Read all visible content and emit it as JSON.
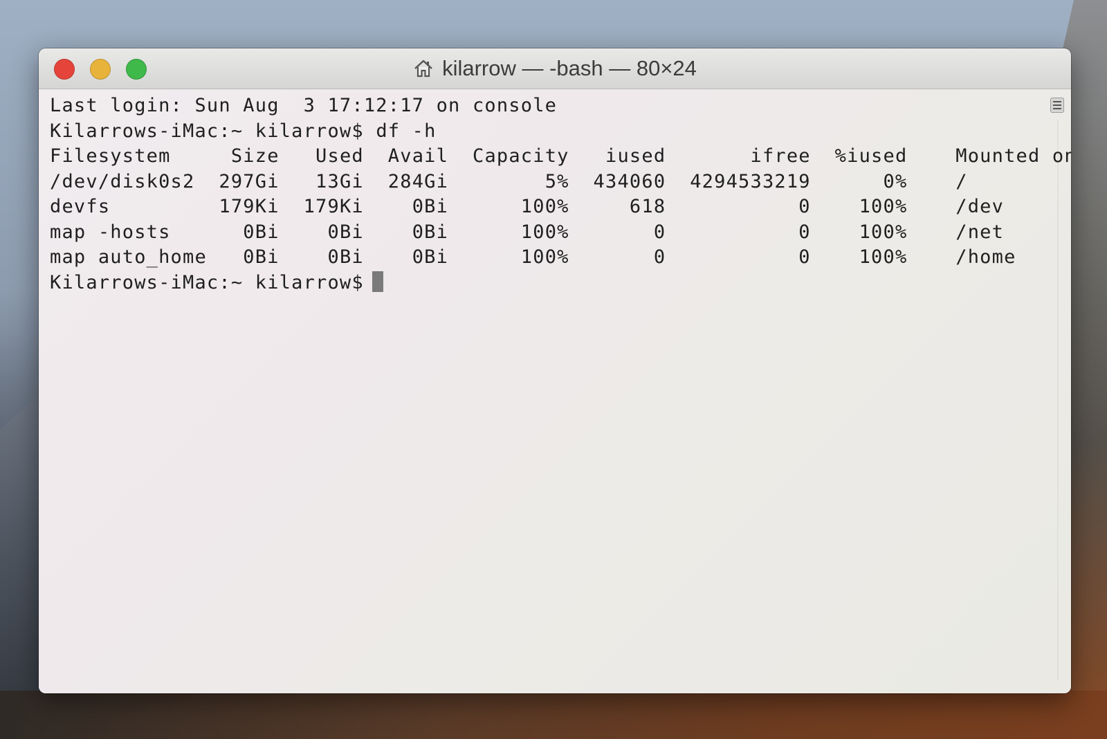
{
  "window": {
    "title": "kilarrow — -bash — 80×24",
    "title_icon": "home-icon"
  },
  "terminal": {
    "login_line": "Last login: Sun Aug  3 17:12:17 on console",
    "prompt": "Kilarrows-iMac:~ kilarrow$",
    "command": "df -h",
    "table": {
      "headers": [
        "Filesystem",
        "Size",
        "Used",
        "Avail",
        "Capacity",
        "iused",
        "ifree",
        "%iused",
        "Mounted on"
      ],
      "rows": [
        [
          "/dev/disk0s2",
          "297Gi",
          "13Gi",
          "284Gi",
          "5%",
          "434060",
          "4294533219",
          "0%",
          "/"
        ],
        [
          "devfs",
          "179Ki",
          "179Ki",
          "0Bi",
          "100%",
          "618",
          "0",
          "100%",
          "/dev"
        ],
        [
          "map -hosts",
          "0Bi",
          "0Bi",
          "0Bi",
          "100%",
          "0",
          "0",
          "100%",
          "/net"
        ],
        [
          "map auto_home",
          "0Bi",
          "0Bi",
          "0Bi",
          "100%",
          "0",
          "0",
          "100%",
          "/home"
        ]
      ]
    }
  },
  "colors": {
    "close": "#e5443a",
    "minimize": "#e8b33a",
    "zoom": "#3fb94a"
  }
}
